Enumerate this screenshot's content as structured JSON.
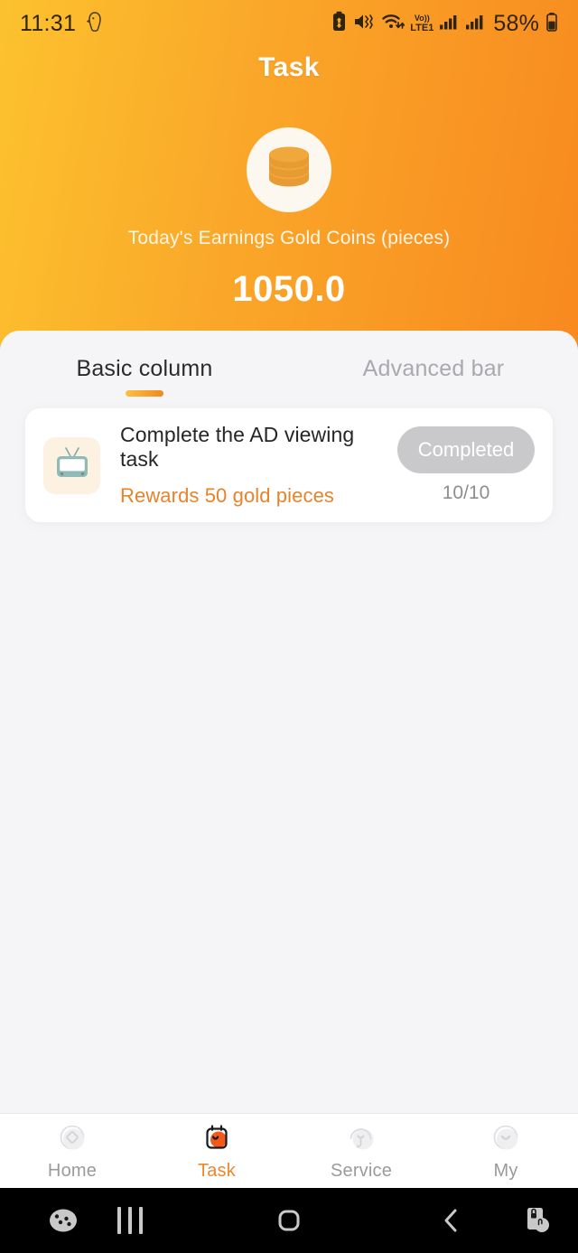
{
  "status_bar": {
    "time": "11:31",
    "left_icons": [
      "chick-icon"
    ],
    "right_icons": [
      "alarm-icon",
      "mute-vibrate-icon",
      "wifi-icon",
      "volte-lte1-icon",
      "signal-sim1-icon",
      "signal-sim2-icon"
    ],
    "network_top": "Vo))",
    "network_bottom": "LTE1",
    "battery_percent": "58%"
  },
  "header": {
    "title": "Task",
    "coin_icon": "coin-stack-icon",
    "earnings_label": "Today's Earnings Gold Coins (pieces)",
    "earnings_value": "1050.0",
    "gradient_from": "#FCC22E",
    "gradient_to": "#F8891F"
  },
  "tabs": [
    {
      "label": "Basic column",
      "active": true
    },
    {
      "label": "Advanced bar",
      "active": false
    }
  ],
  "tasks": [
    {
      "icon": "retro-tv-icon",
      "title": "Complete the AD viewing task",
      "reward": "Rewards 50 gold pieces",
      "action_label": "Completed",
      "progress": "10/10",
      "reward_color": "#E8832A",
      "button_color": "#C9C9CC"
    }
  ],
  "bottom_nav": [
    {
      "label": "Home",
      "icon": "home-diamond-icon",
      "active": false
    },
    {
      "label": "Task",
      "icon": "calendar-task-icon",
      "active": true
    },
    {
      "label": "Service",
      "icon": "headset-service-icon",
      "active": false
    },
    {
      "label": "My",
      "icon": "user-profile-icon",
      "active": false
    }
  ],
  "system_nav": [
    {
      "icon": "game-controller-icon"
    },
    {
      "icon": "recents-icon"
    },
    {
      "icon": "home-icon"
    },
    {
      "icon": "back-icon"
    },
    {
      "icon": "screen-touch-icon"
    }
  ],
  "colors": {
    "accent": "#F0862A",
    "sheet_bg": "#F5F5F7",
    "card_bg": "#FFFFFF"
  }
}
